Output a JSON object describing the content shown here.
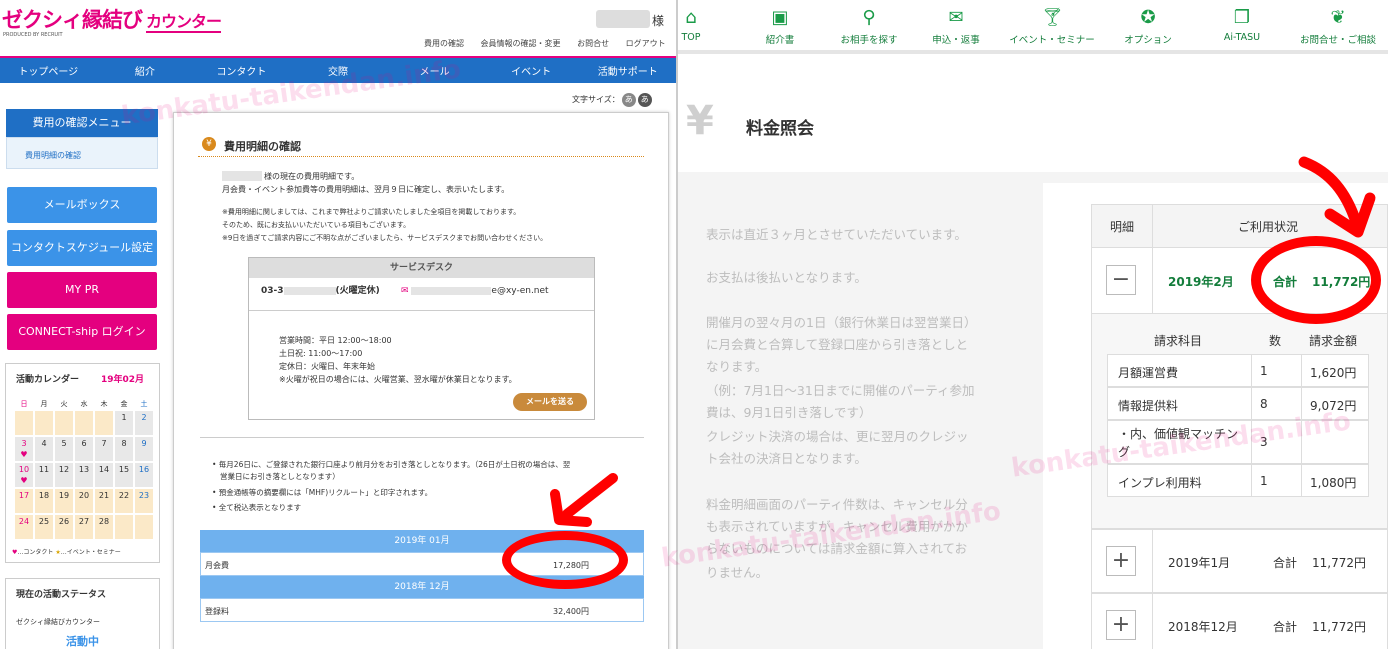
{
  "left": {
    "brand": {
      "logo": "ゼクシィ縁結び",
      "counter": "カウンター",
      "produced": "PRODUCED BY RECRUIT"
    },
    "user": {
      "honorific": "様"
    },
    "toplinks": [
      "費用の確認",
      "会員情報の確認・変更",
      "お問合せ",
      "ログアウト"
    ],
    "gnav": [
      "トップページ",
      "紹介",
      "コンタクト",
      "交際",
      "メール",
      "イベント",
      "活動サポート"
    ],
    "font_size": {
      "label": "文字サイズ：",
      "small": "あ",
      "large": "あ"
    },
    "sidebar": {
      "menu_title": "費用の確認メニュー",
      "menu_item": "費用明細の確認",
      "buttons": [
        "メールボックス",
        "コンタクトスケジュール設定",
        "MY PR",
        "CONNECT-ship ログイン"
      ],
      "calendar": {
        "title": "活動カレンダー",
        "month": "19年02月",
        "weekdays": [
          "日",
          "月",
          "火",
          "水",
          "木",
          "金",
          "土"
        ],
        "legend_contact": "…コンタクト",
        "legend_event": "…イベント・セミナー"
      },
      "status": {
        "title": "現在の活動ステータス",
        "sub": "ゼクシィ縁結びカウンター",
        "value": "活動中"
      }
    },
    "main": {
      "title": "費用明細の確認",
      "intro1": "様の現在の費用明細です。",
      "intro2": "月会費・イベント参加費等の費用明細は、翌月９日に確定し、表示いたします。",
      "note1": "※費用明細に関しましては、これまで弊社よりご請求いたしました全項目を掲載しております。",
      "note2": "そのため、既にお支払いいただいている項目もございます。",
      "note3": "※9日を過ぎてご請求内容にご不明な点がございましたら、サービスデスクまでお問い合わせください。",
      "service_desk": {
        "title": "サービスデスク",
        "phone": "03-3",
        "phone_note": "(火曜定休)",
        "email": "e@xy-en.net",
        "hours1": "営業時間：平日 12:00～18:00",
        "hours2": "土日祝: 11:00～17:00",
        "hours3": "定休日：火曜日、年末年始",
        "hours4": "※火曜が祝日の場合には、火曜営業、翌水曜が休業日となります。",
        "mail_button": "メールを送る"
      },
      "bullets": [
        "• 毎月26日に、ご登録された銀行口座より前月分をお引き落としとなります。（26日が土日祝の場合は、翌",
        "営業日にお引き落としとなります）",
        "• 預金通帳等の摘要欄には「MHF)リクルート」と印字されます。",
        "• 全て税込表示となります"
      ],
      "bill_2019_01": {
        "month": "2019年 01月",
        "item": "月会費",
        "amount": "17,280円"
      },
      "bill_2018_12": {
        "month": "2018年 12月",
        "item": "登録料",
        "amount": "32,400円"
      }
    }
  },
  "right": {
    "nav": [
      {
        "label": "TOP",
        "icon": "home-icon"
      },
      {
        "label": "紹介書",
        "icon": "profile-book-icon"
      },
      {
        "label": "お相手を探す",
        "icon": "search-icon"
      },
      {
        "label": "申込・返事",
        "icon": "mail-icon"
      },
      {
        "label": "イベント・セミナー",
        "icon": "cocktail-icon"
      },
      {
        "label": "オプション",
        "icon": "badge-icon"
      },
      {
        "label": "Ai-TASU",
        "icon": "book-icon"
      },
      {
        "label": "お問合せ・ご相談",
        "icon": "consult-icon"
      }
    ],
    "page_title": "料金照会",
    "yen_symbol": "¥",
    "notice": [
      "表示は直近３ヶ月とさせていただいています。",
      "お支払は後払いとなります。",
      "開催月の翌々月の1日（銀行休業日は翌営業日）",
      "に月会費と合算して登録口座から引き落としと",
      "なります。",
      "（例：7月1日～31日までに開催のパーティ参加",
      "費は、9月1日引き落しです）",
      "クレジット決済の場合は、更に翌月のクレジッ",
      "ト会社の決済日となります。",
      "料金明細画面のパーティ件数は、キャンセル分",
      "も表示されていますが、キャンセル費用がかか",
      "らないものについては請求金額に算入されてお",
      "りません。"
    ],
    "table": {
      "header_detail": "明細",
      "header_usage": "ご利用状況",
      "total_label": "合計",
      "months": [
        {
          "month": "2019年2月",
          "total": "11,772円",
          "expanded": true
        },
        {
          "month": "2019年1月",
          "total": "11,772円",
          "expanded": false
        },
        {
          "month": "2018年12月",
          "total": "11,772円",
          "expanded": false
        }
      ],
      "sub_headers": [
        "請求科目",
        "数",
        "請求金額"
      ],
      "items": [
        {
          "name": "月額運営費",
          "qty": "1",
          "amount": "1,620円"
        },
        {
          "name": "情報提供料",
          "qty": "8",
          "amount": "9,072円"
        },
        {
          "name": "・内、価値観マッチン",
          "name2": "グ",
          "qty": "3",
          "amount": ""
        },
        {
          "name": "インプレ利用料",
          "qty": "1",
          "amount": "1,080円"
        }
      ]
    }
  },
  "watermark": "konkatu-taikendan.info",
  "colors": {
    "brand_pink": "#e4007f",
    "brand_blue": "#1f6fc5",
    "green": "#137d3b",
    "annotation_red": "#ff0000"
  }
}
